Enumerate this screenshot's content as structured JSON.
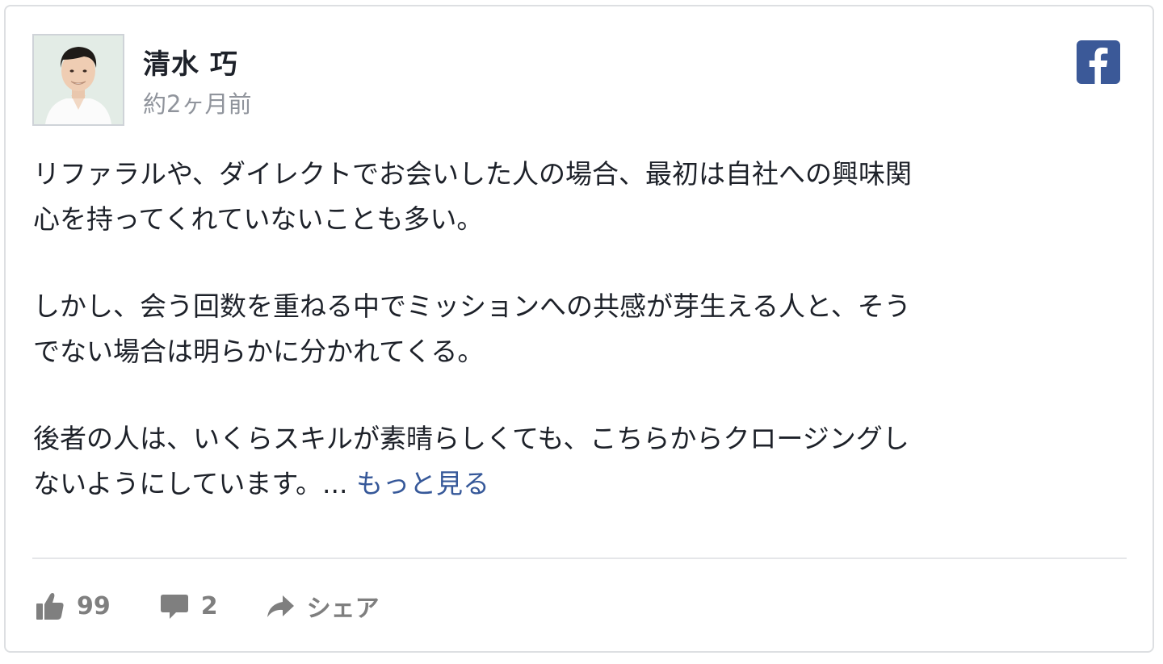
{
  "post": {
    "author": {
      "name": "清水 巧",
      "avatar_icon": "avatar-photo"
    },
    "time": "約2ヶ月前",
    "source_icon": "facebook-icon",
    "paragraphs": [
      [
        "リファラルや、ダイレクトでお会いした人の場合、最初は自社への興味関",
        "心を持ってくれていないことも多い。"
      ],
      [
        "しかし、会う回数を重ねる中でミッションへの共感が芽生える人と、そう",
        "でない場合は明らかに分かれてくる。"
      ],
      [
        "後者の人は、いくらスキルが素晴らしくても、こちらからクロージングし",
        "ないようにしています。..."
      ]
    ],
    "see_more": "もっと見る"
  },
  "actions": {
    "likes": "99",
    "comments": "2",
    "share_label": "シェア"
  },
  "colors": {
    "facebook_blue": "#3b5998",
    "link_blue": "#365899",
    "muted_gray": "#90949c",
    "action_gray": "#7f7f7f"
  }
}
